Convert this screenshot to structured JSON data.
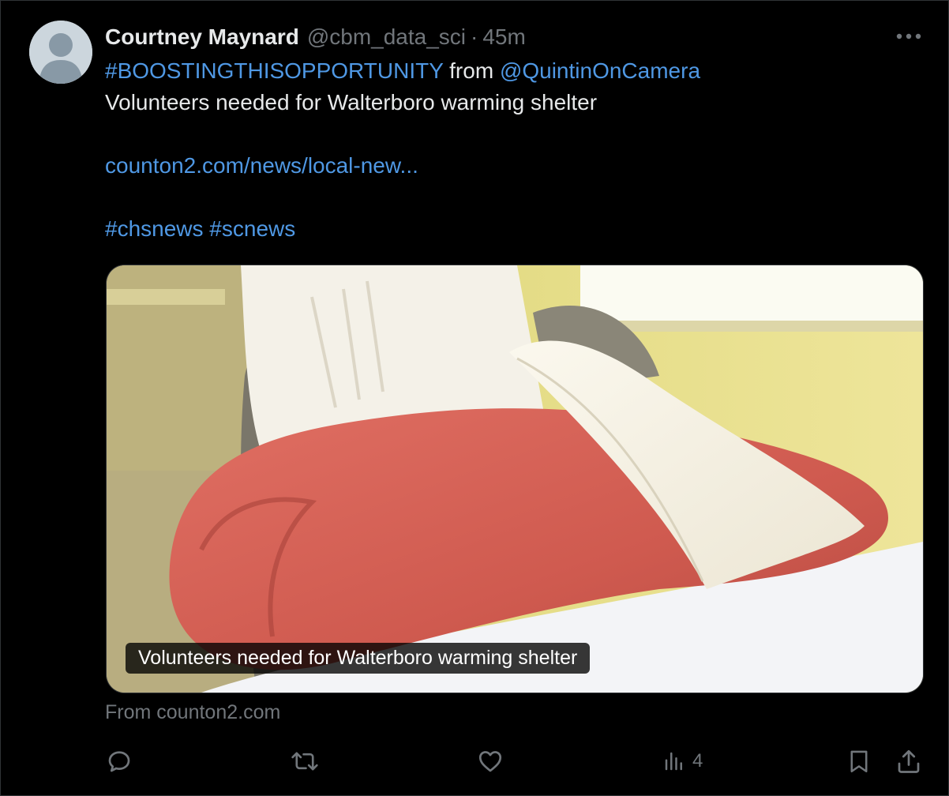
{
  "tweet": {
    "author_name": "Courtney Maynard",
    "author_handle": "@cbm_data_sci",
    "separator": "·",
    "time": "45m",
    "hashtag_boost": "#BOOSTINGTHISOPPORTUNITY",
    "from_word": "from",
    "mention": "@QuintinOnCamera",
    "headline": "Volunteers needed for Walterboro warming shelter",
    "link": "counton2.com/news/local-new...",
    "hashtags": [
      "#chsnews",
      "#scnews"
    ]
  },
  "card": {
    "caption": "Volunteers needed for Walterboro warming shelter",
    "source": "From counton2.com"
  },
  "actions": {
    "views_count": "4"
  },
  "icons": {
    "more": "more-horizontal-icon",
    "reply": "reply-icon",
    "retweet": "retweet-icon",
    "like": "heart-icon",
    "views": "views-chart-icon",
    "bookmark": "bookmark-icon",
    "share": "share-icon"
  },
  "colors": {
    "background": "#000000",
    "text": "#e7e9ea",
    "secondary": "#71767b",
    "link": "#4f98e4",
    "border": "#2f3336"
  }
}
